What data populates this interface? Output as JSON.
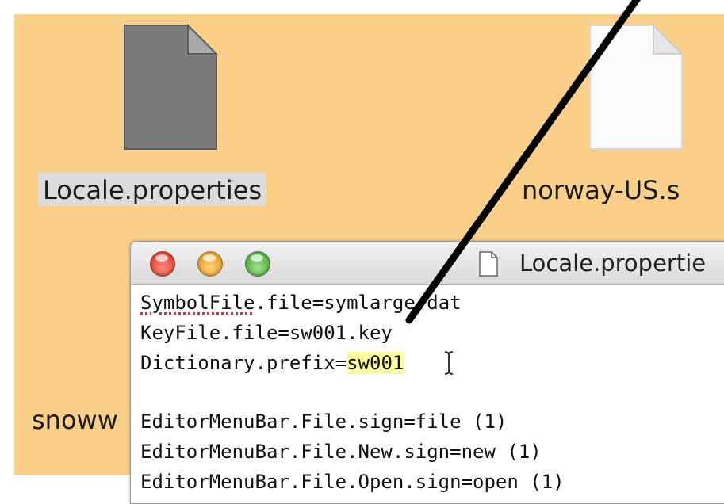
{
  "desktop": {
    "icons": [
      {
        "label": "Locale.properties",
        "selected": true,
        "graphic": "gray-document-icon"
      },
      {
        "label": "norway-US.s",
        "selected": false,
        "graphic": "white-document-icon"
      },
      {
        "label": "snoww",
        "selected": false,
        "graphic": "none"
      }
    ]
  },
  "window": {
    "title": "Locale.propertie",
    "title_icon": "document-icon",
    "buttons": [
      "close",
      "minimize",
      "zoom"
    ]
  },
  "editor": {
    "line1_key": "SymbolFile",
    "line1_rest": ".file=symlarge.dat",
    "line2": "KeyFile.file=sw001.key",
    "line3_prefix": "Dictionary.prefix=",
    "line3_selected": "sw001",
    "line5": "EditorMenuBar.File.sign=file (1)",
    "line6": "EditorMenuBar.File.New.sign=new (1)",
    "line7": "EditorMenuBar.File.Open.sign=open (1)"
  },
  "colors": {
    "desktop_bg": "#f9cf8a",
    "selection_highlight": "#fffca0",
    "spellcheck_underline": "#e03030",
    "label_selection_bg": "#dcdcdc"
  }
}
